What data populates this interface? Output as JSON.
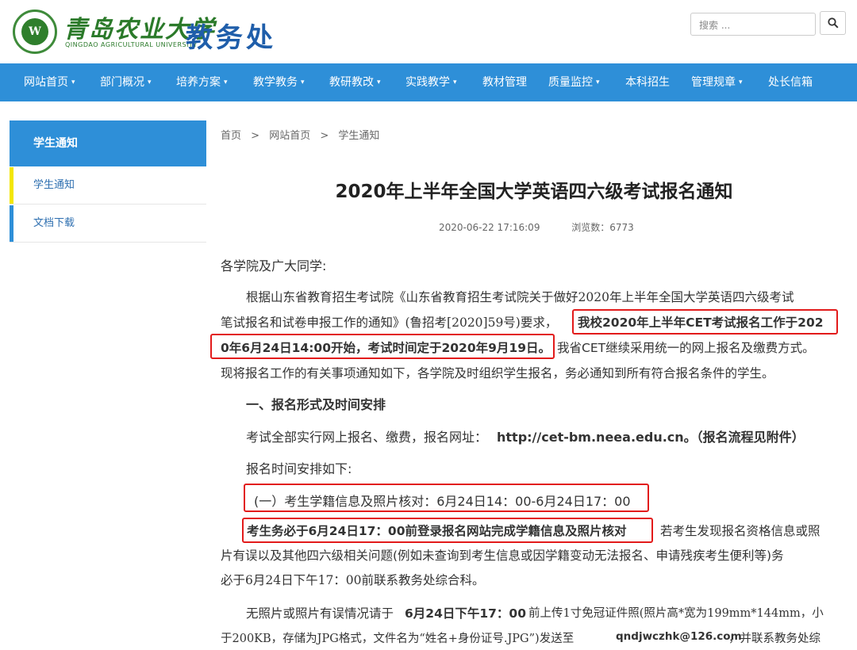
{
  "header": {
    "logo_cn": "青岛农业大学",
    "logo_en": "QINGDAO AGRICULTURAL UNIVERSITY",
    "logo_badge": "W",
    "dept_title": "教务处",
    "search_placeholder": "搜索 ..."
  },
  "nav": {
    "items": [
      {
        "label": "网站首页",
        "caret": "▾"
      },
      {
        "label": "部门概况",
        "caret": "▾"
      },
      {
        "label": "培养方案",
        "caret": "▾"
      },
      {
        "label": "教学教务",
        "caret": "▾"
      },
      {
        "label": "教研教改",
        "caret": "▾"
      },
      {
        "label": "实践教学",
        "caret": "▾"
      },
      {
        "label": "教材管理",
        "caret": ""
      },
      {
        "label": "质量监控",
        "caret": "▾"
      },
      {
        "label": "本科招生",
        "caret": ""
      },
      {
        "label": "管理规章",
        "caret": "▾"
      },
      {
        "label": "处长信箱",
        "caret": ""
      }
    ]
  },
  "sidebar": {
    "title": "学生通知",
    "items": [
      {
        "label": "学生通知",
        "active": true
      },
      {
        "label": "文档下载",
        "active": false
      }
    ]
  },
  "breadcrumb": {
    "home": "首页",
    "sep": ">",
    "level1": "网站首页",
    "level2": "学生通知"
  },
  "article": {
    "title": "2020年上半年全国大学英语四六级考试报名通知",
    "date": "2020-06-22 17:16:09",
    "views": "浏览数：6773",
    "greeting": "各学院及广大同学:",
    "p1_l1": "根据山东省教育招生考试院《山东省教育招生考试院关于做好2020年上半年全国大学英语四六级考试",
    "p1_l2a": "笔试报名和试卷申报工作的通知》(鲁招考[2020]59号)要求，",
    "p1_l2b": "我校2020年上半年CET考试报名工作于202",
    "p1_l3a": "0年6月24日14:00开始，考试时间定于2020年9月19日。",
    "p1_l3b": "我省CET继续采用统一的网上报名及缴费方式。",
    "p1_l4": "现将报名工作的有关事项通知如下，各学院及时组织学生报名，务必通知到所有符合报名条件的学生。",
    "section1": "一、报名形式及时间安排",
    "p2a": "考试全部实行网上报名、缴费，报名网址：",
    "p2b": "http://cet-bm.neea.edu.cn。（报名流程见附件）",
    "p3": "报名时间安排如下:",
    "p4": "(一）考生学籍信息及照片核对：6月24日14：00-6月24日17：00",
    "p5_l1a": "考生务必于6月24日17：00前登录报名网站完成学籍信息及照片核对",
    "p5_l1b": "若考生发现报名资格信息或照",
    "p5_l2": "片有误以及其他四六级相关问题(例如未查询到考生信息或因学籍变动无法报名、申请残疾考生便利等)务",
    "p5_l3": "必于6月24日下午17：00前联系教务处综合科。",
    "p6_l1a": "无照片或照片有误情况请于",
    "p6_l1b": "6月24日下午17：00",
    "p6_l1c": "前上传1寸免冠证件照(照片高*宽为199mm*144mm，小",
    "p6_l2a": "于200KB，存储为JPG格式，文件名为“姓名+身份证号.JPG”)发送至",
    "p6_l2b": "qndjwczhk@126.com",
    "p6_l2c": "，并联系教务处综"
  },
  "colors": {
    "nav_bg": "#2e8fd8",
    "highlight_border": "#e21b1b",
    "dept_title": "#1f5eaa",
    "logo_green": "#2b7a2a",
    "sidebar_active_bar": "#f3e600"
  }
}
